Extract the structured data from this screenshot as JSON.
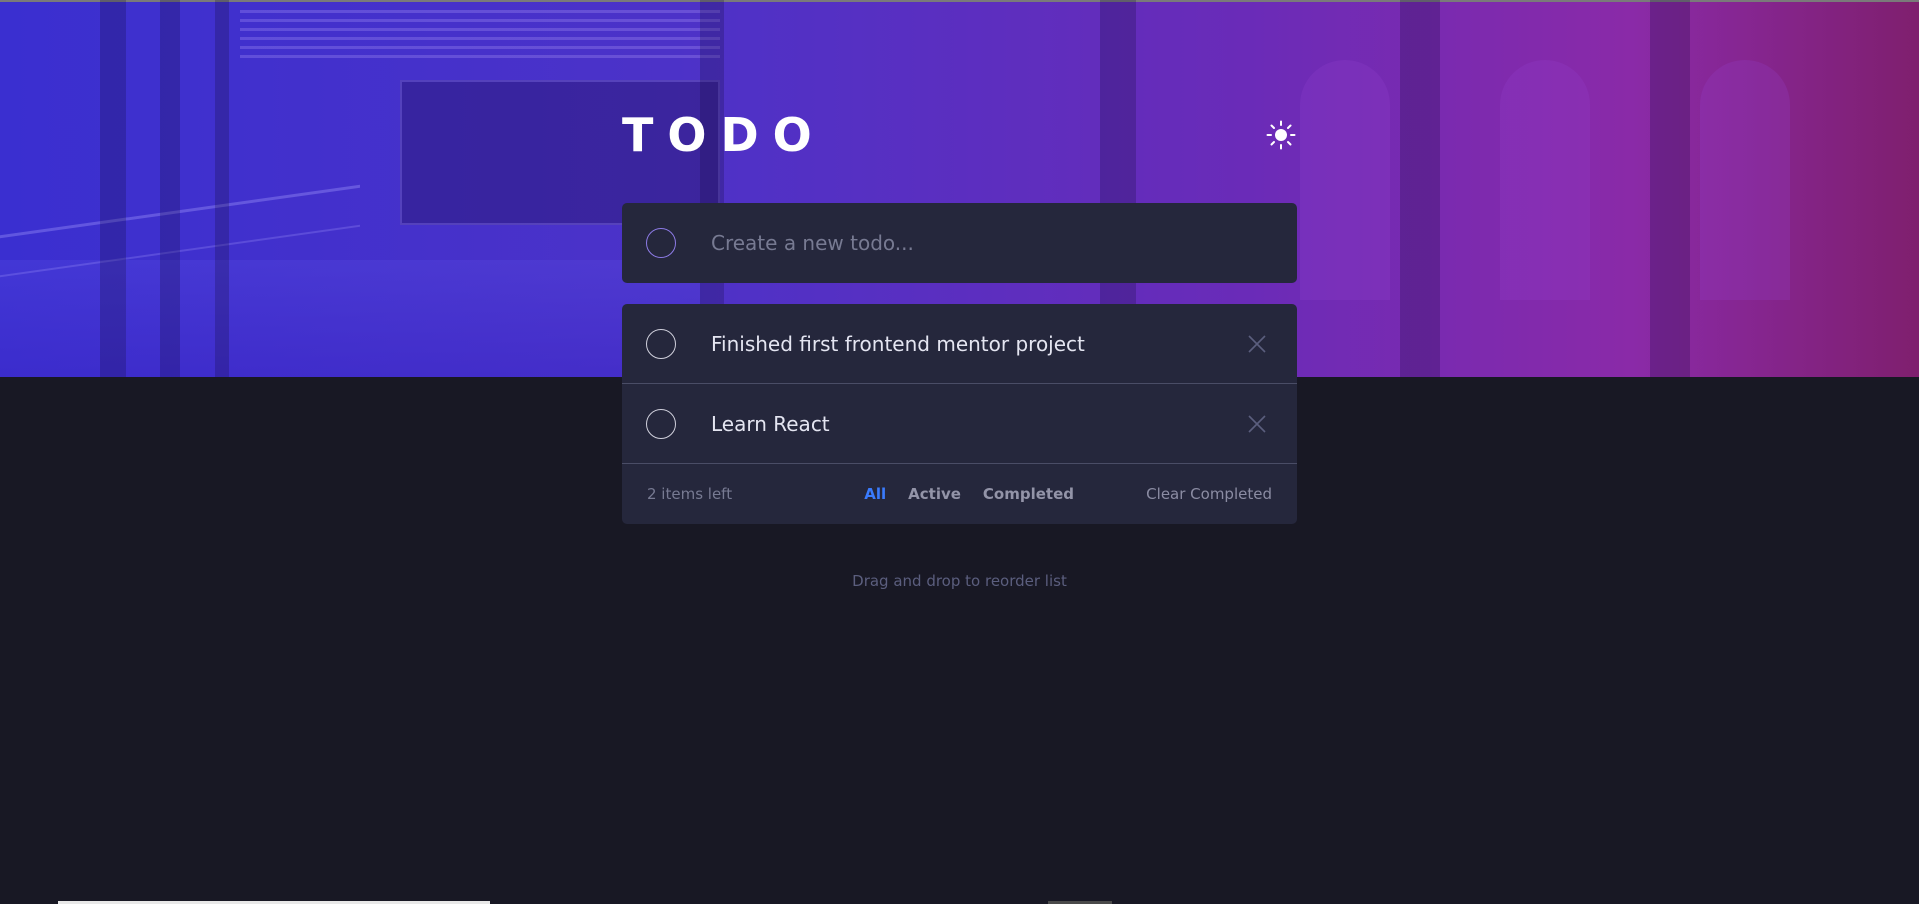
{
  "header": {
    "title": "TODO",
    "theme_icon": "sun-icon"
  },
  "new_todo": {
    "placeholder": "Create a new todo..."
  },
  "todos": [
    {
      "text": "Finished first frontend mentor project",
      "completed": false
    },
    {
      "text": "Learn React",
      "completed": false
    }
  ],
  "footer": {
    "items_left": "2 items left",
    "filters": [
      "All",
      "Active",
      "Completed"
    ],
    "active_filter": "All",
    "clear_label": "Clear Completed"
  },
  "hint": "Drag and drop to reorder list",
  "colors": {
    "background": "#181824",
    "card": "#25273c",
    "accent": "#3a7bfd",
    "text": "#e4e5f1",
    "muted": "#777a92",
    "hero_start": "#3a2fd0",
    "hero_end": "#7f1f6e"
  }
}
